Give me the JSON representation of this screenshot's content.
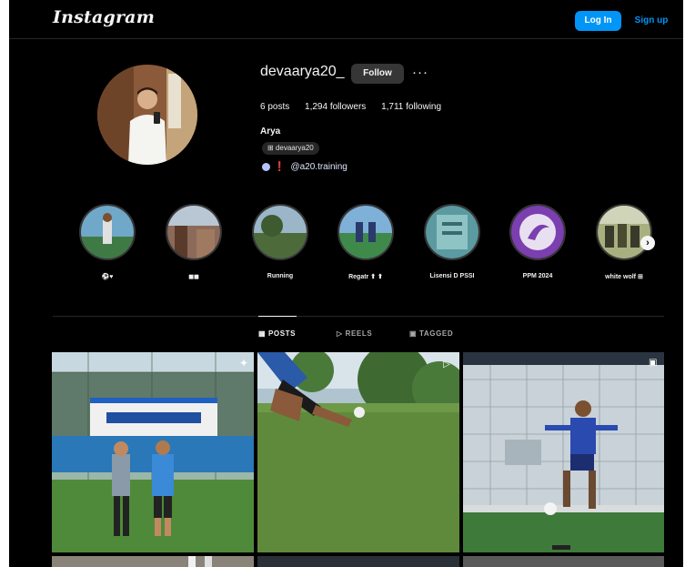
{
  "app": {
    "name": "Instagram"
  },
  "header": {
    "login_label": "Log In",
    "signup_label": "Sign up"
  },
  "profile": {
    "username": "devaarya20_",
    "follow_label": "Follow",
    "more_label": "···",
    "stats": {
      "posts": "6 posts",
      "followers": "1,294 followers",
      "following": "1,711 following"
    },
    "full_name": "Arya",
    "threads_badge": "devaarya20",
    "link_text": "@a20.training"
  },
  "highlights": [
    {
      "label": "⚽♥",
      "icon": "highlight-thumbnail"
    },
    {
      "label": "◼◼",
      "icon": "highlight-thumbnail"
    },
    {
      "label": "Running",
      "icon": "highlight-thumbnail"
    },
    {
      "label": "Regatr ⬆ ⬆",
      "icon": "highlight-thumbnail"
    },
    {
      "label": "Lisensi D PSSI",
      "icon": "highlight-thumbnail"
    },
    {
      "label": "PPM 2024",
      "icon": "highlight-thumbnail"
    },
    {
      "label": "white wolf ⊞",
      "icon": "highlight-thumbnail"
    }
  ],
  "tabs": {
    "posts": "POSTS",
    "reels": "REELS",
    "tagged": "TAGGED"
  },
  "colors": {
    "background": "#000000",
    "accent": "#0095f6",
    "follow_bg": "#363636"
  }
}
